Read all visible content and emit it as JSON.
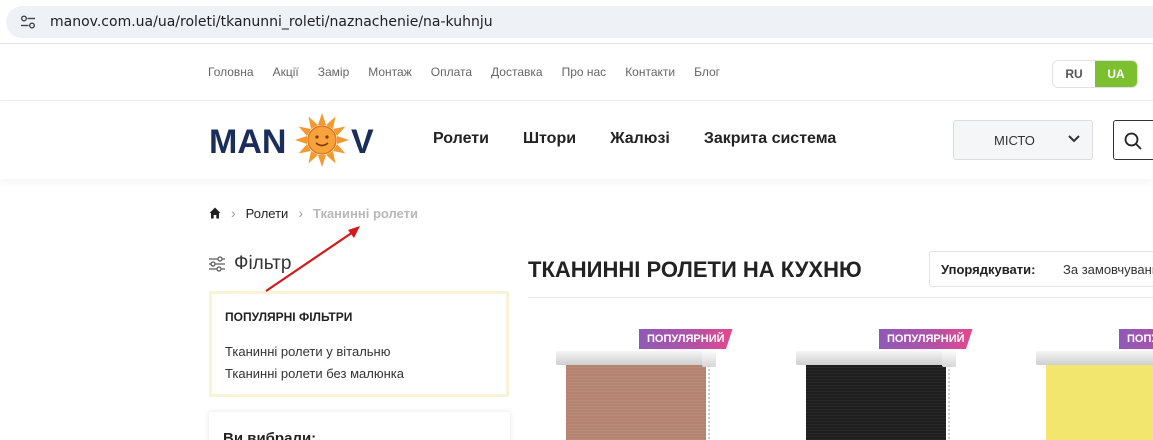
{
  "browser": {
    "url": "manov.com.ua/ua/roleti/tkanunni_roleti/naznachenie/na-kuhnju"
  },
  "top_nav": {
    "links": [
      "Головна",
      "Акції",
      "Замір",
      "Монтаж",
      "Оплата",
      "Доставка",
      "Про нас",
      "Контакти",
      "Блог"
    ],
    "lang_ru": "RU",
    "lang_ua": "UA"
  },
  "header": {
    "logo_text": "MANOV",
    "menu": [
      "Ролети",
      "Штори",
      "Жалюзі",
      "Закрита система"
    ],
    "city": "МІСТО"
  },
  "breadcrumb": {
    "items": [
      "Ролети",
      "Тканинні ролети"
    ]
  },
  "filter": {
    "title": "Фільтр",
    "popular_heading": "ПОПУЛЯРНІ ФІЛЬТРИ",
    "popular_links": [
      "Тканинні ролети у вітальню",
      "Тканинні ролети без малюнка"
    ],
    "chosen_heading": "Ви вибрали:"
  },
  "content": {
    "title": "ТКАНИННІ РОЛЕТИ НА КУХНЮ",
    "sort_label": "Упорядкувати:",
    "sort_value": "За замовчуванням"
  },
  "products": [
    {
      "badge": "ПОПУЛЯРНИЙ",
      "fabric_color": "#b48470"
    },
    {
      "badge": "ПОПУЛЯРНИЙ",
      "fabric_color": "#1e1e1e"
    },
    {
      "badge": "ПОПУЛЯРНИЙ",
      "fabric_color": "#f2e66e"
    }
  ],
  "colors": {
    "accent_green": "#7cbf2f",
    "logo_blue": "#1b2d5a",
    "logo_orange": "#f29a2e",
    "annotation_arrow": "#d21a1a"
  }
}
